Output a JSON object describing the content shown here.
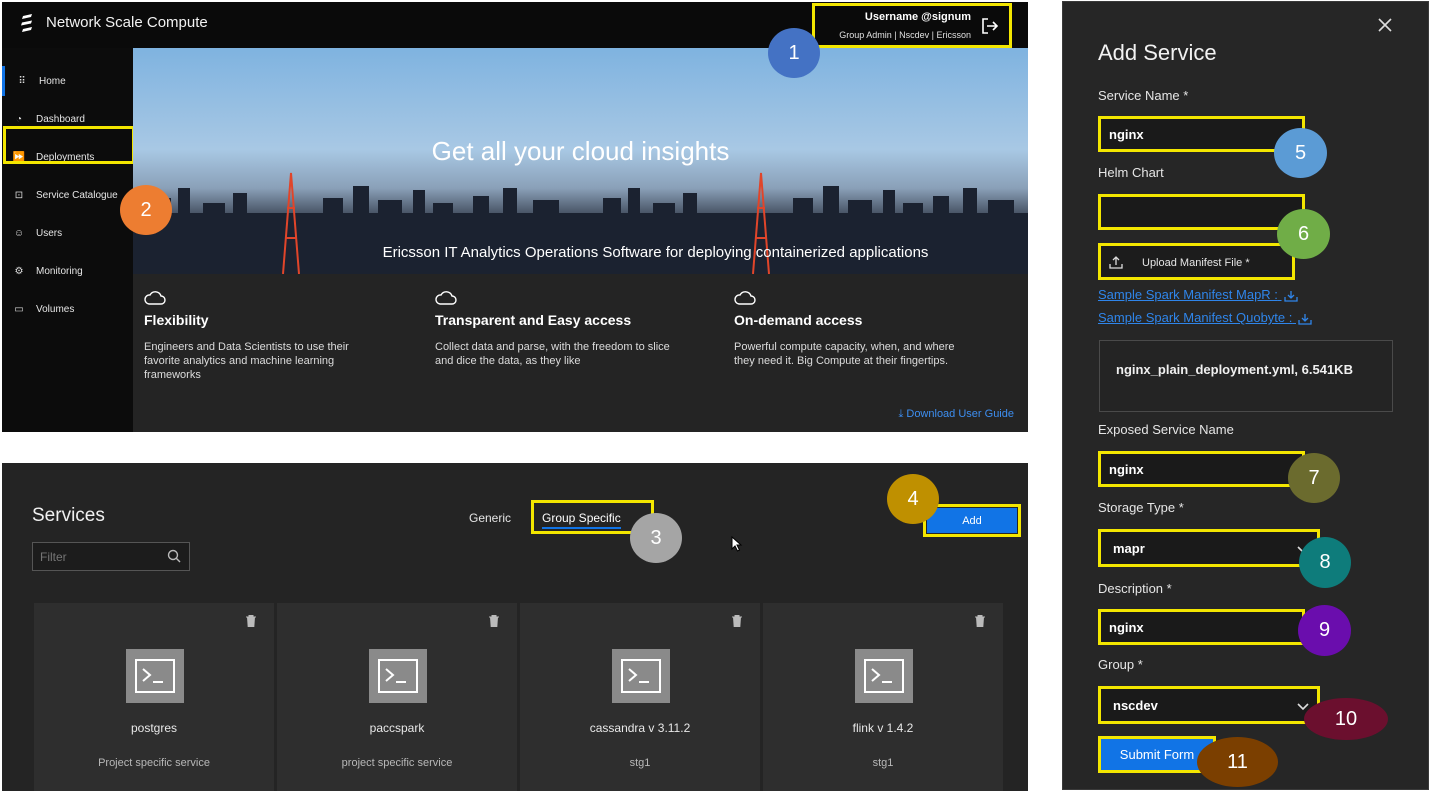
{
  "home": {
    "app_title": "Network Scale Compute",
    "user_name": "Username @signum",
    "user_role": "Group Admin | Nscdev | Ericsson",
    "nav": [
      {
        "label": "Home",
        "icon": "grid-icon"
      },
      {
        "label": "Dashboard",
        "icon": "gauge-icon"
      },
      {
        "label": "Deployments",
        "icon": "fast-forward-icon"
      },
      {
        "label": "Service Catalogue",
        "icon": "terminal-icon"
      },
      {
        "label": "Users",
        "icon": "user-icon"
      },
      {
        "label": "Monitoring",
        "icon": "monitor-icon"
      },
      {
        "label": "Volumes",
        "icon": "folder-icon"
      }
    ],
    "hero_title": "Get all your cloud insights",
    "hero_subtitle": "Ericsson IT Analytics Operations Software for deploying containerized applications",
    "features": [
      {
        "title": "Flexibility",
        "desc": "Engineers and Data Scientists to use their favorite analytics and machine learning frameworks"
      },
      {
        "title": "Transparent and Easy access",
        "desc": "Collect data and parse, with the freedom to slice and dice the data, as they like"
      },
      {
        "title": "On-demand access",
        "desc": "Powerful compute capacity, when, and where they need it. Big Compute at their fingertips."
      }
    ],
    "download_guide": "Download User Guide"
  },
  "services": {
    "title": "Services",
    "filter_placeholder": "Filter",
    "tab_generic": "Generic",
    "tab_group": "Group Specific",
    "add_label": "Add",
    "cards": [
      {
        "name": "postgres",
        "desc": "Project specific service"
      },
      {
        "name": "paccspark",
        "desc": "project specific service"
      },
      {
        "name": "cassandra v 3.11.2",
        "desc": "stg1"
      },
      {
        "name": "flink v 1.4.2",
        "desc": "stg1"
      }
    ]
  },
  "add_service": {
    "title": "Add Service",
    "service_name_label": "Service Name *",
    "service_name_value": "nginx",
    "helm_chart_label": "Helm Chart",
    "helm_chart_value": "",
    "upload_label": "Upload Manifest File *",
    "sample_mapr": "Sample Spark Manifest MapR :",
    "sample_quobyte": "Sample Spark Manifest Quobyte :",
    "file_info": "nginx_plain_deployment.yml, 6.541KB",
    "exposed_label": "Exposed Service Name",
    "exposed_value": "nginx",
    "storage_label": "Storage Type *",
    "storage_value": "mapr",
    "description_label": "Description *",
    "description_value": "nginx",
    "group_label": "Group *",
    "group_value": "nscdev",
    "submit_label": "Submit Form"
  },
  "callouts": [
    {
      "n": "1",
      "color": "#4472c4"
    },
    {
      "n": "2",
      "color": "#ed7d31"
    },
    {
      "n": "3",
      "color": "#a5a5a5"
    },
    {
      "n": "4",
      "color": "#bf9000"
    },
    {
      "n": "5",
      "color": "#5b9bd5"
    },
    {
      "n": "6",
      "color": "#70ad47"
    },
    {
      "n": "7",
      "color": "#6b6b2e"
    },
    {
      "n": "8",
      "color": "#0e7c7b"
    },
    {
      "n": "9",
      "color": "#6a0dad"
    },
    {
      "n": "10",
      "color": "#6b0f2e"
    },
    {
      "n": "11",
      "color": "#7b3f00"
    }
  ]
}
